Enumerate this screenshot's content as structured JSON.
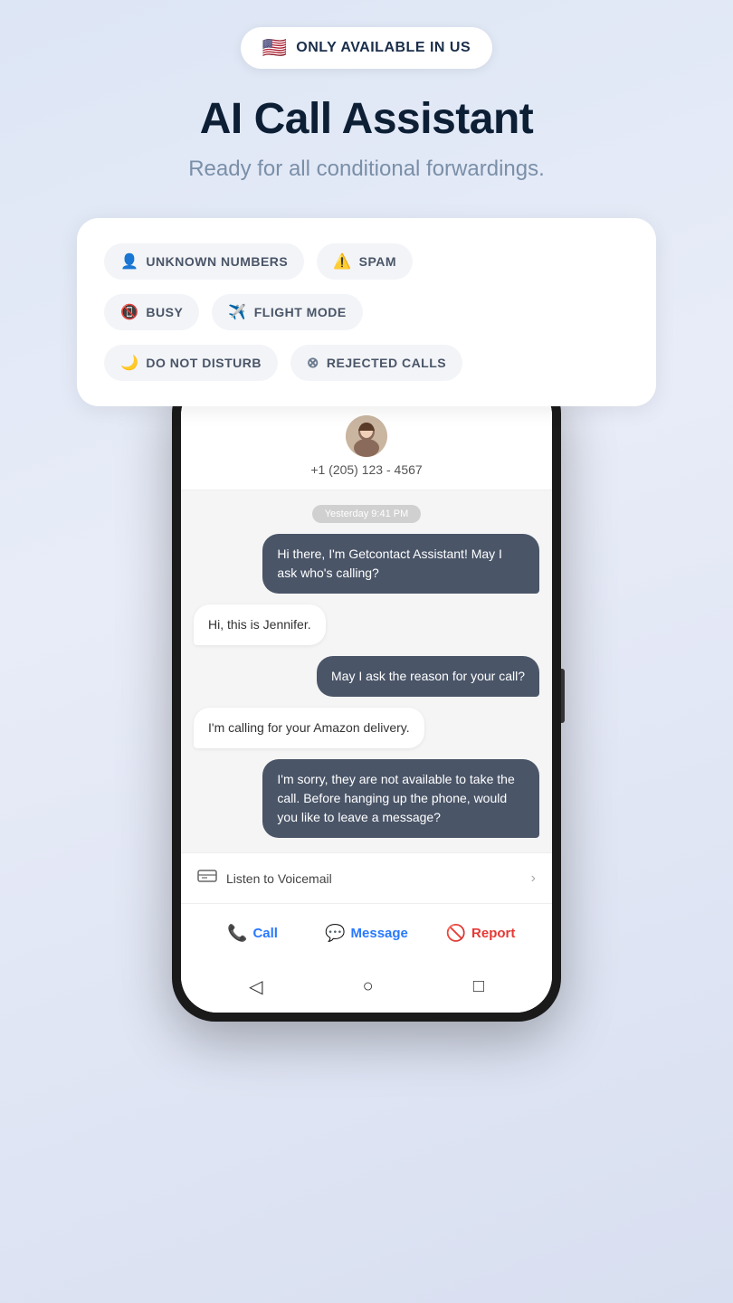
{
  "badge": {
    "flag": "🇺🇸",
    "text": "ONLY AVAILABLE IN US"
  },
  "hero": {
    "title": "AI Call Assistant",
    "subtitle": "Ready for all conditional forwardings."
  },
  "features": [
    [
      {
        "icon": "👤",
        "label": "UNKNOWN NUMBERS"
      },
      {
        "icon": "⚠️",
        "label": "SPAM"
      }
    ],
    [
      {
        "icon": "📵",
        "label": "BUSY"
      },
      {
        "icon": "✈️",
        "label": "FLIGHT MODE"
      }
    ],
    [
      {
        "icon": "🌙",
        "label": "DO NOT DISTURB"
      },
      {
        "icon": "⊗",
        "label": "REJECTED CALLS"
      }
    ]
  ],
  "phone": {
    "contact_number": "+1 (205) 123 - 4567",
    "timestamp": "Yesterday 9:41 PM",
    "messages": [
      {
        "type": "ai",
        "text": "Hi there, I'm Getcontact Assistant! May I ask who's calling?"
      },
      {
        "type": "user",
        "text": "Hi, this is Jennifer."
      },
      {
        "type": "ai",
        "text": "May I ask the reason for your call?"
      },
      {
        "type": "user",
        "text": "I'm calling for your Amazon delivery."
      },
      {
        "type": "ai",
        "text": "I'm sorry, they are not available to take the call. Before hanging up the phone, would you like to leave a message?"
      }
    ],
    "voicemail_label": "Listen to Voicemail",
    "actions": {
      "call": "Call",
      "message": "Message",
      "report": "Report"
    }
  }
}
